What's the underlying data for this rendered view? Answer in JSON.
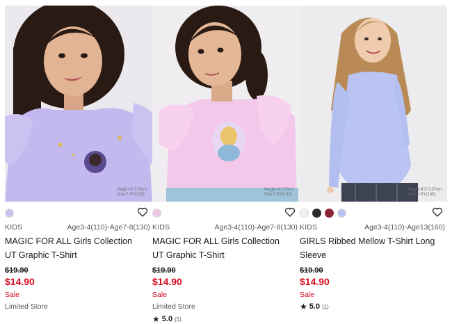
{
  "products": [
    {
      "size_note": [
        "Height:4'/123cm",
        "Size:7-8Y(130)"
      ],
      "colors": [
        "#c9c3ee"
      ],
      "gender": "KIDS",
      "sizes": "Age3-4(110)-Age7-8(130)",
      "name_line1": "MAGIC FOR ALL Girls Collection",
      "name_line2": "UT Graphic T-Shirt",
      "original_price": "$19.90",
      "sale_price": "$14.90",
      "flag": "Sale",
      "availability": "Limited Store"
    },
    {
      "size_note": [
        "Height:4'/123cm",
        "Size:7-8Y(130)"
      ],
      "colors": [
        "#f0c8e4"
      ],
      "gender": "KIDS",
      "sizes": "Age3-4(110)-Age7-8(130)",
      "name_line1": "MAGIC FOR ALL Girls Collection",
      "name_line2": "UT Graphic T-Shirt",
      "original_price": "$19.90",
      "sale_price": "$14.90",
      "flag": "Sale",
      "availability": "Limited Store",
      "rating": "5.0",
      "review_count": "(1)"
    },
    {
      "size_note": [
        "Height:4'3\"/137cm",
        "Size:7-8Y(130)"
      ],
      "colors": [
        "#f3f1ec",
        "#2b2b2b",
        "#8c2330",
        "#b9c3f0"
      ],
      "gender": "KIDS",
      "sizes": "Age3-4(110)-Age13(160)",
      "name_line1": "GIRLS Ribbed Mellow T-Shirt Long",
      "name_line2": "Sleeve",
      "original_price": "$19.90",
      "sale_price": "$14.90",
      "flag": "Sale",
      "rating": "5.0",
      "review_count": "(1)"
    }
  ]
}
